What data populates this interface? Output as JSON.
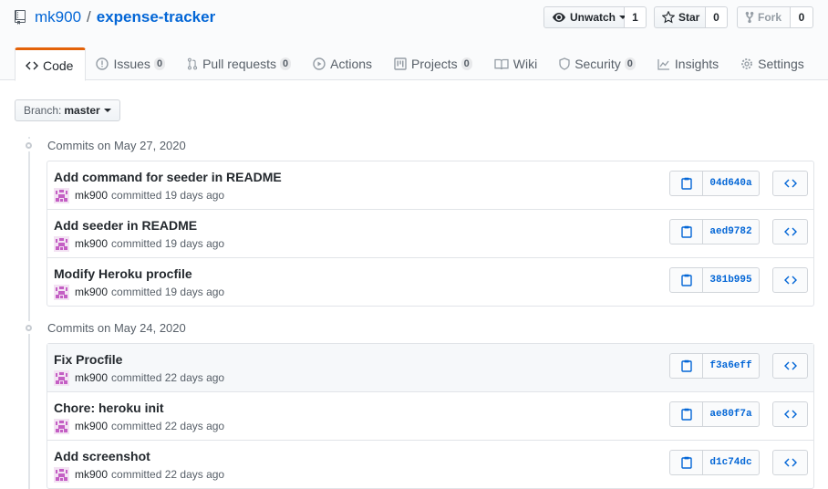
{
  "repo": {
    "owner": "mk900",
    "separator": "/",
    "name": "expense-tracker"
  },
  "actions": {
    "watch": {
      "label": "Unwatch",
      "count": "1"
    },
    "star": {
      "label": "Star",
      "count": "0"
    },
    "fork": {
      "label": "Fork",
      "count": "0"
    }
  },
  "tabs": [
    {
      "label": "Code",
      "icon": "code-icon"
    },
    {
      "label": "Issues",
      "count": "0",
      "icon": "issue-icon"
    },
    {
      "label": "Pull requests",
      "count": "0",
      "icon": "pull-request-icon"
    },
    {
      "label": "Actions",
      "icon": "play-icon"
    },
    {
      "label": "Projects",
      "count": "0",
      "icon": "project-icon"
    },
    {
      "label": "Wiki",
      "icon": "book-icon"
    },
    {
      "label": "Security",
      "count": "0",
      "icon": "shield-icon"
    },
    {
      "label": "Insights",
      "icon": "graph-icon"
    },
    {
      "label": "Settings",
      "icon": "gear-icon"
    }
  ],
  "branch": {
    "label": "Branch:",
    "value": "master"
  },
  "groups": [
    {
      "heading": "Commits on May 27, 2020",
      "commits": [
        {
          "message": "Add command for seeder in README",
          "author": "mk900",
          "when": "committed 19 days ago",
          "sha": "04d640a"
        },
        {
          "message": "Add seeder in README",
          "author": "mk900",
          "when": "committed 19 days ago",
          "sha": "aed9782"
        },
        {
          "message": "Modify Heroku procfile",
          "author": "mk900",
          "when": "committed 19 days ago",
          "sha": "381b995"
        }
      ]
    },
    {
      "heading": "Commits on May 24, 2020",
      "commits": [
        {
          "message": "Fix Procfile",
          "author": "mk900",
          "when": "committed 22 days ago",
          "sha": "f3a6eff"
        },
        {
          "message": "Chore: heroku init",
          "author": "mk900",
          "when": "committed 22 days ago",
          "sha": "ae80f7a"
        },
        {
          "message": "Add screenshot",
          "author": "mk900",
          "when": "committed 22 days ago",
          "sha": "d1c74dc"
        }
      ]
    }
  ],
  "colors": {
    "link": "#0366d6",
    "selected_tab_accent": "#e36209",
    "muted": "#586069",
    "border": "#e1e4e8"
  }
}
